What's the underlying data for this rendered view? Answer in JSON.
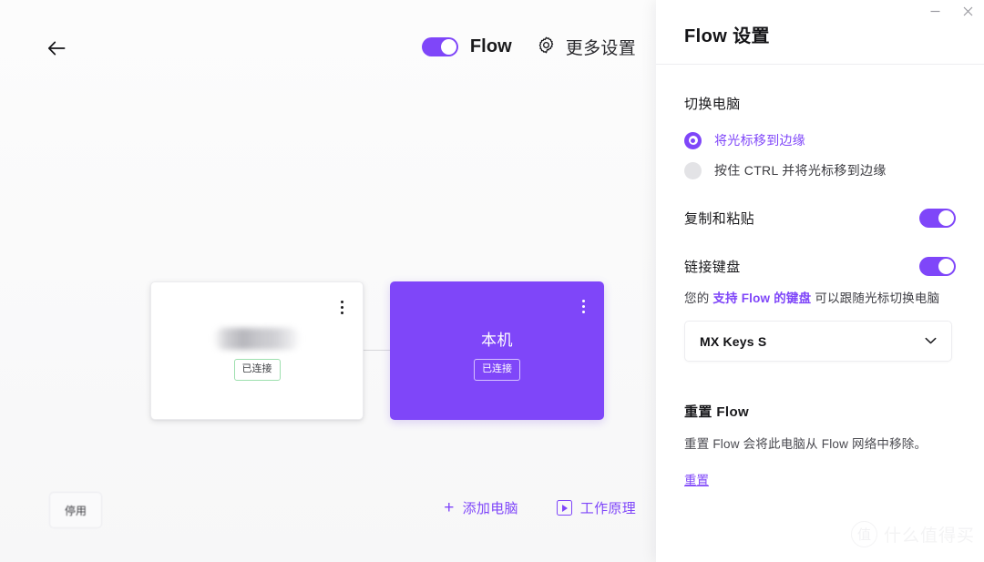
{
  "window": {
    "minimize_label": "−",
    "close_label": "×"
  },
  "main": {
    "back_icon": "arrow-left-icon",
    "flow_toggle": {
      "label": "Flow",
      "state": "on"
    },
    "more_settings": {
      "icon": "gear-icon",
      "label": "更多设置"
    },
    "devices": [
      {
        "name": "",
        "name_hidden": true,
        "badge": "已连接",
        "is_local": false,
        "menu_icon": "kebab-menu-icon"
      },
      {
        "name": "本机",
        "name_hidden": false,
        "badge": "已连接",
        "is_local": true,
        "menu_icon": "kebab-menu-icon"
      }
    ],
    "bottom": {
      "disable_label": "停用",
      "add_computer": {
        "icon": "plus-icon",
        "label": "添加电脑"
      },
      "how_it_works": {
        "icon": "play-video-icon",
        "label": "工作原理"
      }
    }
  },
  "settings": {
    "title": "Flow 设置",
    "switch_computer": {
      "heading": "切换电脑",
      "options": [
        {
          "label": "将光标移到边缘",
          "selected": true
        },
        {
          "label": "按住 CTRL 并将光标移到边缘",
          "selected": false
        }
      ]
    },
    "copy_paste": {
      "label": "复制和粘贴",
      "state": "on"
    },
    "link_keyboard": {
      "label": "链接键盘",
      "state": "on",
      "helper_prefix": "您的 ",
      "helper_link": "支持 Flow 的键盘",
      "helper_suffix": " 可以跟随光标切换电脑",
      "selected_keyboard": "MX Keys S",
      "chevron_icon": "chevron-down-icon"
    },
    "reset": {
      "title": "重置 Flow",
      "description": "重置 Flow 会将此电脑从 Flow 网络中移除。",
      "link_label": "重置"
    }
  },
  "watermark": {
    "logo_char": "值",
    "text": "什么值得买"
  },
  "colors": {
    "accent": "#7f46f9",
    "card_local_bg": "#7f46f9",
    "badge_green_border": "#9ddfae",
    "main_bg": "#fbfbfb"
  }
}
